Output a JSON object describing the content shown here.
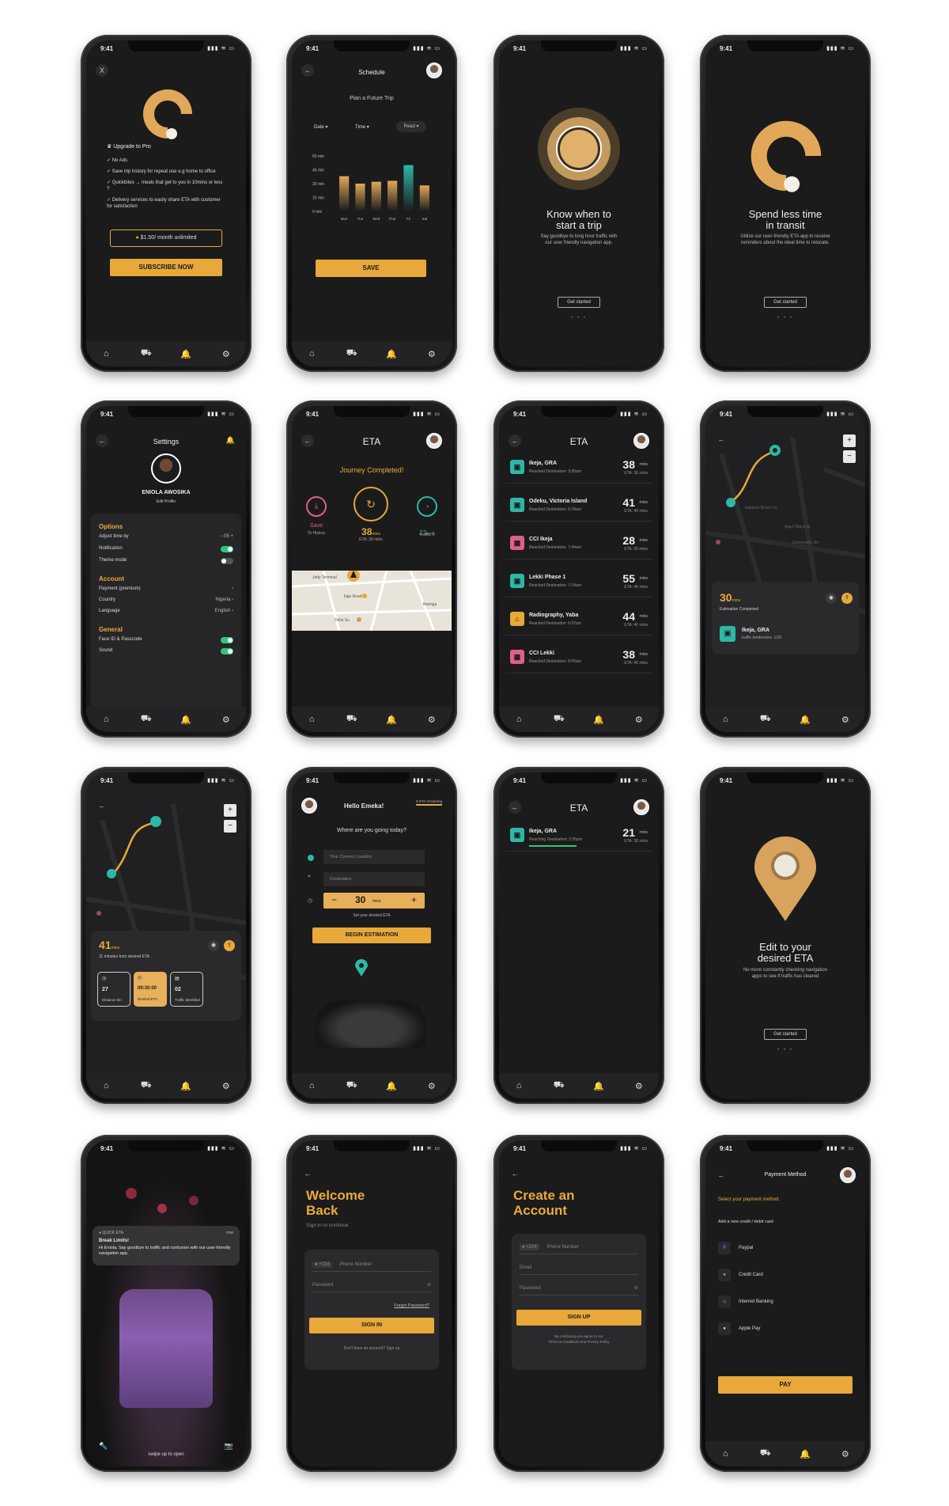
{
  "status_time": "9:41",
  "status_icons": "▮▮▮ ≋ ▭",
  "tabbar": [
    "⌂",
    "⛟",
    "🔔",
    "⚙"
  ],
  "colors": {
    "accent": "#e8a83a",
    "bg": "#1b1b1c",
    "teal": "#2db8a6",
    "pink": "#e05f8a"
  },
  "s1": {
    "close": "X",
    "upgrade": "Upgrade to Pro",
    "features": [
      "No Ads",
      "Save trip history for repeat use e.g home to office",
      "Quickbites → meals that get to you in 10mins or less ?",
      "Delivery services to easily share ETA with customer for satisfaction"
    ],
    "price": "$1.50/ month unlimited",
    "cta": "SUBSCRIBE NOW"
  },
  "s2": {
    "title": "Schedule",
    "subtitle": "Plan a Future Trip",
    "filters": [
      "Date ▾",
      "Time ▾",
      "Read ▾"
    ],
    "cta": "SAVE",
    "chart_data": {
      "type": "bar",
      "categories": [
        "Mon",
        "Tue",
        "Wed",
        "Thur",
        "Fri",
        "Sat"
      ],
      "values": [
        38,
        30,
        32,
        33,
        50,
        28
      ],
      "ylabels": [
        "60 min",
        "45 min",
        "30 min",
        "15 min",
        "0 min"
      ],
      "ylim": [
        0,
        60
      ]
    }
  },
  "s3": {
    "title1": "Know when to",
    "title2": "start a trip",
    "desc1": "Say goodbye to long hour traffic with",
    "desc2": "our user friendly navigation app.",
    "cta": "Get started",
    "dots": "• • •"
  },
  "s4": {
    "title1": "Spend less time",
    "title2": "in transit",
    "desc1": "Utilize our user-friendly ETA app to receive",
    "desc2": "reminders about the ideal time to relocate.",
    "cta": "Get started",
    "dots": "• • •"
  },
  "s5": {
    "title": "Settings",
    "name": "ENIOLA AWOSIKA",
    "edit": "Edit Profile",
    "options": "Options",
    "adjust": "Adjust time by",
    "adjust_val": "− 05 +",
    "notification": "Notification",
    "theme": "Theme mode",
    "account": "Account",
    "payment": "Payment (premium)",
    "country": "Country",
    "country_val": "Nigeria",
    "language": "Language",
    "language_val": "English",
    "general": "General",
    "faceid": "Face ID & Passcode",
    "sound": "Sound"
  },
  "s6": {
    "title": "ETA",
    "headline": "Journey Completed!",
    "save": "Save",
    "save_sub": "To History",
    "mins_num": "38",
    "mins_unit": "mins",
    "mins_sub": "ETA: 30 mins",
    "speed": "27",
    "speed_unit": "km/h",
    "speed_sub": "Traffic: 2",
    "map_labels": [
      "Jetty Terminal",
      "Ilaje Road",
      "Beenga",
      "Delia Su"
    ]
  },
  "s7": {
    "title": "ETA",
    "items": [
      {
        "name": "Ikeja, GRA",
        "sub": "Reached Destination: 3:35pm",
        "num": "38",
        "unit": "mins",
        "eta": "ETA: 30 mins",
        "icon": "▣"
      },
      {
        "name": "Odeku, Victoria Island",
        "sub": "Reached Destination: 6:24am",
        "num": "41",
        "unit": "mins",
        "eta": "ETA: 40 mins",
        "icon": "▣"
      },
      {
        "name": "CCI Ikeja",
        "sub": "Reached Destination: 7:44am",
        "num": "28",
        "unit": "mins",
        "eta": "ETA: 30 mins",
        "icon": "▦"
      },
      {
        "name": "Lekki Phase 1",
        "sub": "Reached Destination: 7:14am",
        "num": "55",
        "unit": "mins",
        "eta": "ETA: 45 mins",
        "icon": "▣"
      },
      {
        "name": "Radiography, Yaba",
        "sub": "Reached Destination: 6:37pm",
        "num": "44",
        "unit": "mins",
        "eta": "ETA: 40 mins",
        "icon": "⌂"
      },
      {
        "name": "CCI Lekki",
        "sub": "Reached Destination: 8:05am",
        "num": "38",
        "unit": "mins",
        "eta": "ETA: 40 mins",
        "icon": "▦"
      }
    ]
  },
  "s8": {
    "num": "30",
    "unit": "mins",
    "sub": "Estimation Completed",
    "place": "Ikeja, GRA",
    "place_sub": "traffic tendencies: 1/10",
    "plus": "+",
    "minus": "−",
    "streets": [
      "Adebola Brown St",
      "Ajayi Olaiya St",
      "Community Rd"
    ]
  },
  "s9": {
    "num": "41",
    "unit": "mins",
    "sub": "11 minutes from desired ETA",
    "stats": [
      {
        "val": "27",
        "label": "Distance km"
      },
      {
        "val": "00:30:00",
        "label": "Desired ETA"
      },
      {
        "val": "02",
        "label": "Traffic Identified"
      }
    ],
    "plus": "+",
    "minus": "−"
  },
  "s10": {
    "hello": "Hello Emeka!",
    "remaining": "5 ETA remaining",
    "question": "Where are you going today?",
    "current": "Your Current Location",
    "destination": "Destination",
    "minus": "−",
    "num": "30",
    "unit": "mins",
    "plus": "+",
    "desired": "Set your desired ETA",
    "cta": "BEGIN ESTIMATION"
  },
  "s11": {
    "title": "ETA",
    "name": "Ikeja, GRA",
    "sub": "Reaching Destination: 3:35pm",
    "num": "21",
    "unit": "mins",
    "eta": "ETA: 30 mins"
  },
  "s12": {
    "title1": "Edit to your",
    "title2": "desired ETA",
    "desc1": "No more constantly checking navigation",
    "desc2": "apps to see if traffic has cleared",
    "cta": "Get started",
    "dots": "• • •"
  },
  "s13": {
    "app": "QUICK ETA",
    "when": "now",
    "heading": "Break Limits!",
    "body": "Hi Eniola, Say goodbye to traffic and confusion with our user-friendly navigation app.",
    "swipe": "swipe up to open"
  },
  "s14": {
    "title1": "Welcome",
    "title2": "Back",
    "sub": "Sign in to continue",
    "code": "+234",
    "phone": "Phone Number",
    "password": "Password",
    "forgot": "Forgot Password?",
    "cta": "SIGN IN",
    "footer": "Don't have an account? Sign up"
  },
  "s15": {
    "title1": "Create an",
    "title2": "Account",
    "code": "+234",
    "phone": "Phone Number",
    "email": "Email",
    "password": "Password",
    "cta": "SIGN UP",
    "terms1": "By continuing you agree to our",
    "terms2": "Terms & Conditions and Privacy Policy"
  },
  "s16": {
    "title": "Payment Method",
    "select": "Select your payment method.",
    "add": "Add a new credit / debit card",
    "methods": [
      "Paypal",
      "Credit Card",
      "Internet Banking",
      "Apple Pay"
    ],
    "cta": "PAY"
  }
}
